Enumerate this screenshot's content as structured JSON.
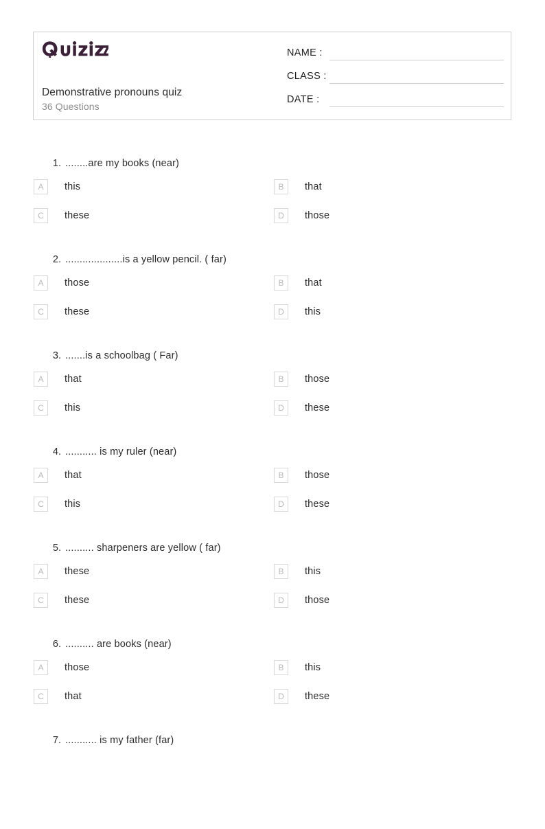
{
  "page": {
    "background": "#ffffff",
    "brand_color": "#3b2038"
  },
  "header": {
    "logo_text": "Quizizz",
    "quiz_title": "Demonstrative pronouns quiz",
    "question_count_label": "36 Questions",
    "fields": [
      {
        "label": "NAME :",
        "value": ""
      },
      {
        "label": "CLASS :",
        "value": ""
      },
      {
        "label": "DATE  :",
        "value": ""
      }
    ]
  },
  "questions": [
    {
      "number": "1.",
      "text": "........are my books (near)",
      "options": [
        {
          "letter": "A",
          "text": "this"
        },
        {
          "letter": "B",
          "text": "that"
        },
        {
          "letter": "C",
          "text": "these"
        },
        {
          "letter": "D",
          "text": "those"
        }
      ]
    },
    {
      "number": "2.",
      "text": "....................is a yellow pencil. ( far)",
      "options": [
        {
          "letter": "A",
          "text": "those"
        },
        {
          "letter": "B",
          "text": "that"
        },
        {
          "letter": "C",
          "text": "these"
        },
        {
          "letter": "D",
          "text": "this"
        }
      ]
    },
    {
      "number": "3.",
      "text": ".......is a schoolbag ( Far)",
      "options": [
        {
          "letter": "A",
          "text": "that"
        },
        {
          "letter": "B",
          "text": "those"
        },
        {
          "letter": "C",
          "text": "this"
        },
        {
          "letter": "D",
          "text": "these"
        }
      ]
    },
    {
      "number": "4.",
      "text": "........... is my ruler (near)",
      "options": [
        {
          "letter": "A",
          "text": "that"
        },
        {
          "letter": "B",
          "text": "those"
        },
        {
          "letter": "C",
          "text": "this"
        },
        {
          "letter": "D",
          "text": "these"
        }
      ]
    },
    {
      "number": "5.",
      "text": ".......... sharpeners are yellow ( far)",
      "options": [
        {
          "letter": "A",
          "text": "these"
        },
        {
          "letter": "B",
          "text": "this"
        },
        {
          "letter": "C",
          "text": "these"
        },
        {
          "letter": "D",
          "text": "those"
        }
      ]
    },
    {
      "number": "6.",
      "text": ".......... are books (near)",
      "options": [
        {
          "letter": "A",
          "text": "those"
        },
        {
          "letter": "B",
          "text": "this"
        },
        {
          "letter": "C",
          "text": "that"
        },
        {
          "letter": "D",
          "text": "these"
        }
      ]
    },
    {
      "number": "7.",
      "text": "........... is my father (far)",
      "options": []
    }
  ]
}
